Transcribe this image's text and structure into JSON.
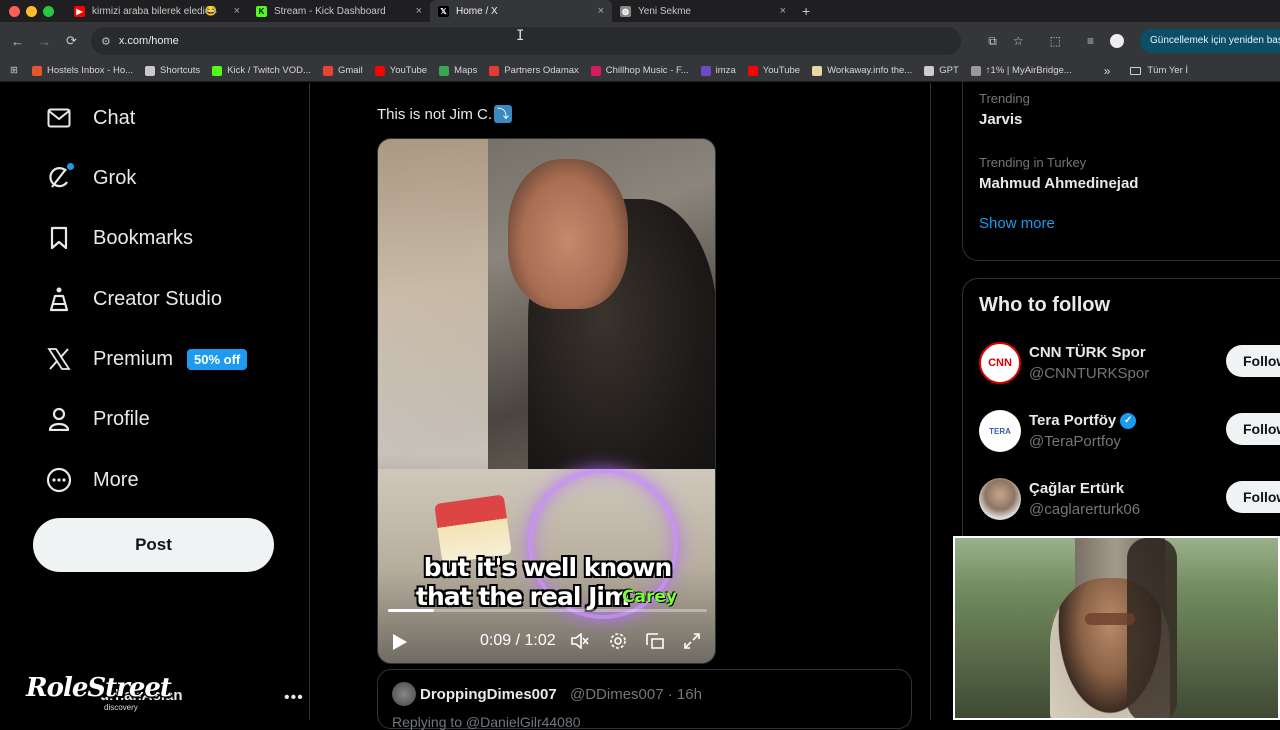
{
  "browser": {
    "tabs": [
      {
        "title": "kirmizi araba bilerek eledi😂",
        "favicon_color": "#ff0000",
        "favicon_glyph": "▶",
        "active": false
      },
      {
        "title": "Stream - Kick Dashboard",
        "favicon_color": "#53fc18",
        "favicon_glyph": "K",
        "active": false
      },
      {
        "title": "Home / X",
        "favicon_color": "#000000",
        "favicon_glyph": "𝕏",
        "active": true
      },
      {
        "title": "Yeni Sekme",
        "favicon_color": "#888888",
        "favicon_glyph": "◍",
        "active": false
      }
    ],
    "new_tab": "+",
    "close_glyph": "×",
    "url": "x.com/home",
    "update_label": "Güncellemek için yeniden başlatın",
    "bookmarks": [
      {
        "label": "Hostels Inbox - Ho...",
        "color": "#e4572e"
      },
      {
        "label": "Shortcuts",
        "color": "#c8c8c8"
      },
      {
        "label": "Kick / Twitch VOD...",
        "color": "#53fc18"
      },
      {
        "label": "Gmail",
        "color": "#ea4335"
      },
      {
        "label": "YouTube",
        "color": "#ff0000"
      },
      {
        "label": "Maps",
        "color": "#34a853"
      },
      {
        "label": "Partners Odamax",
        "color": "#e53935"
      },
      {
        "label": "Chillhop Music - F...",
        "color": "#d81b60"
      },
      {
        "label": "imza",
        "color": "#6a4bc4"
      },
      {
        "label": "YouTube",
        "color": "#ff0000"
      },
      {
        "label": "Workaway.info the...",
        "color": "#e8d7a0"
      },
      {
        "label": "GPT",
        "color": "#cccccc"
      },
      {
        "label": "↑1% | MyAirBridge...",
        "color": "#999999"
      }
    ],
    "bookmarks_more": "»",
    "all_bookmarks": "Tüm Yer İ"
  },
  "sidebar": {
    "items": [
      {
        "label": "Chat",
        "icon": "mail-icon"
      },
      {
        "label": "Grok",
        "icon": "grok-icon"
      },
      {
        "label": "Bookmarks",
        "icon": "bookmark-icon"
      },
      {
        "label": "Creator Studio",
        "icon": "flask-icon"
      },
      {
        "label": "Premium",
        "icon": "x-logo-icon"
      },
      {
        "label": "Profile",
        "icon": "person-icon"
      },
      {
        "label": "More",
        "icon": "more-circle-icon"
      }
    ],
    "premium_badge": "50% off",
    "post_button": "Post",
    "account_name": "urhanAslan",
    "account_more": "•••"
  },
  "overlay": {
    "watermark": "RoleStreet",
    "watermark_sub": "discovery"
  },
  "tweet": {
    "text": "This is not Jim C.",
    "emoji": "⤵",
    "video": {
      "caption_line1": "but it's well known",
      "caption_line2": "that the real Jim",
      "caption_highlight": "Carey",
      "time": "0:09 / 1:02",
      "progress": 0.145
    }
  },
  "reply": {
    "name": "DroppingDimes007",
    "handle": "@DDimes007 · 16h",
    "sub": "Replying to @DanielGilr44080"
  },
  "trends": [
    {
      "category": "Trending",
      "name": "Jarvis"
    },
    {
      "category": "Trending in Turkey",
      "name": "Mahmud Ahmedinejad"
    }
  ],
  "show_more": "Show more",
  "who_to_follow": {
    "title": "Who to follow",
    "follow_label": "Follow",
    "accounts": [
      {
        "name": "CNN TÜRK Spor",
        "handle": "@CNNTURKSpor",
        "verified": false,
        "avatar_text": "CNN"
      },
      {
        "name": "Tera Portföy",
        "handle": "@TeraPortfoy",
        "verified": true,
        "avatar_text": "TERA"
      },
      {
        "name": "Çağlar Ertürk",
        "handle": "@caglarerturk06",
        "verified": false,
        "avatar_text": ""
      }
    ]
  },
  "colors": {
    "accent": "#1d9bf0",
    "traffic_red": "#ff5f57",
    "traffic_yellow": "#febc2e",
    "traffic_green": "#28c840"
  }
}
